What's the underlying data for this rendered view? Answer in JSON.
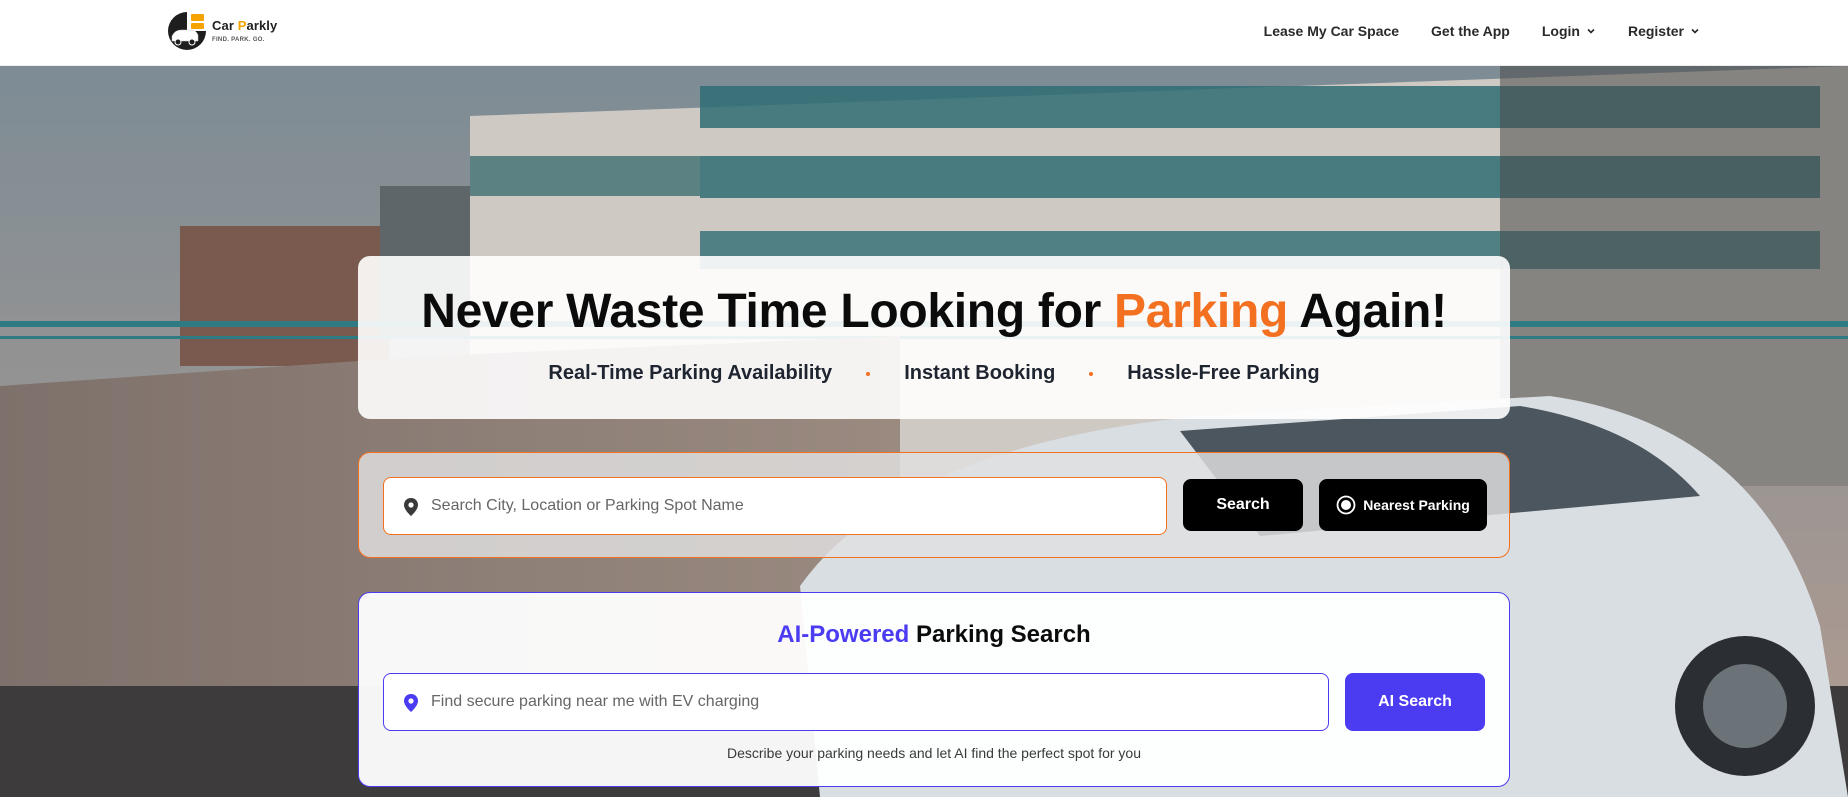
{
  "brand": {
    "name_prefix": "Car ",
    "name_p": "P",
    "name_suffix": "arkly",
    "tagline": "FIND. PARK. GO."
  },
  "nav": {
    "items": [
      {
        "label": "Lease My Car Space",
        "dropdown": false
      },
      {
        "label": "Get the App",
        "dropdown": false
      },
      {
        "label": "Login",
        "dropdown": true
      },
      {
        "label": "Register",
        "dropdown": true
      }
    ]
  },
  "hero": {
    "title_before": "Never Waste Time Looking for ",
    "title_accent": "Parking",
    "title_after": " Again!",
    "features": [
      "Real-Time Parking Availability",
      "Instant Booking",
      "Hassle-Free Parking"
    ]
  },
  "search": {
    "placeholder": "Search City, Location or Parking Spot Name",
    "search_label": "Search",
    "nearest_label": "Nearest Parking"
  },
  "ai": {
    "title_accent": "AI-Powered",
    "title_rest": " Parking Search",
    "placeholder": "Find secure parking near me with EV charging",
    "button_label": "AI Search",
    "hint": "Describe your parking needs and let AI find the perfect spot for you"
  },
  "colors": {
    "accent_orange": "#f37021",
    "accent_purple": "#4b3cf2",
    "dark": "#000000"
  }
}
